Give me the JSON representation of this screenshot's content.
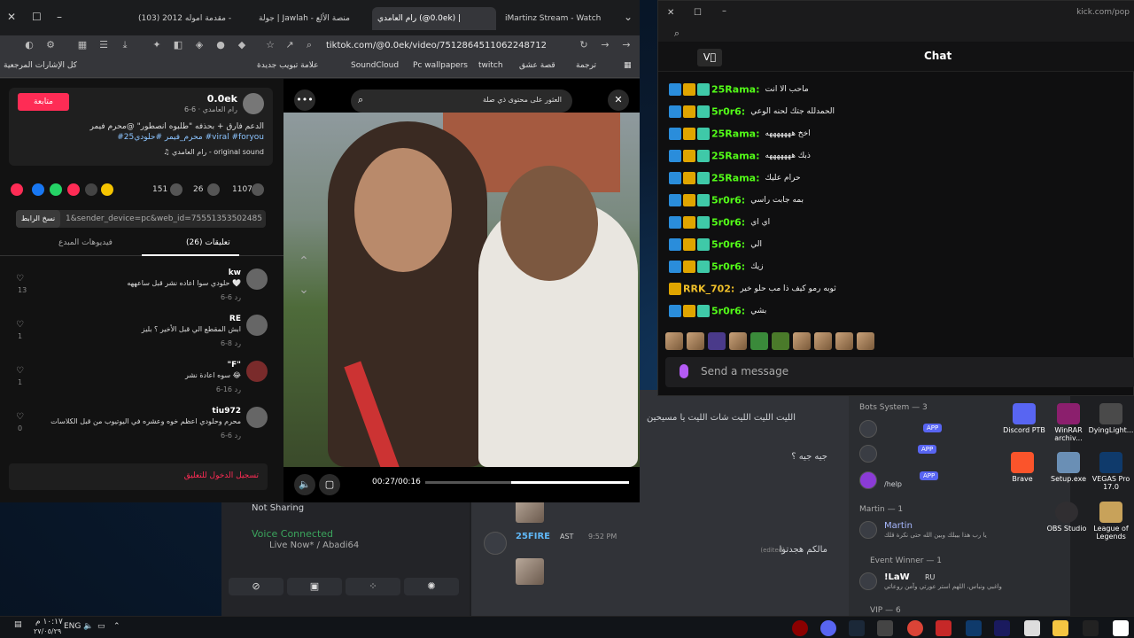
{
  "browser": {
    "tabs": [
      {
        "label": "(103) مقدمة اموله 2012 - "
      },
      {
        "label": "جولة | Jawlah - منصة الألع"
      },
      {
        "label": "رام العامدي (@0.0ek) | "
      },
      {
        "label": "iMartinz Stream - Watch"
      }
    ],
    "url": "tiktok.com/@0.0ek/video/7512864511062248712",
    "bookmarks": [
      {
        "label": "كل الإشارات المرجعية"
      },
      {
        "label": "علامة تبويب جديدة"
      },
      {
        "label": "SoundCloud"
      },
      {
        "label": "Pc wallpapers"
      },
      {
        "label": "twitch"
      },
      {
        "label": "قصة عشق"
      },
      {
        "label": "ترجمة"
      }
    ]
  },
  "tiktok": {
    "follow_label": "متابعة",
    "username": "0.0ek",
    "subtitle": "رام العامدي · 6-6",
    "description": "الدعم فارق + بحذفه \"طلبوه انصطور\" @محرم فيمر",
    "tags": "#محرم_فيمر #حلودي25 #viral #foryou",
    "sound": "رام العامدي - original sound",
    "stats": {
      "likes": "1107",
      "comments": "26",
      "saves": "151"
    },
    "copy_label": "نسخ الرابط",
    "link": "1&sender_device=pc&web_id=7555135350248506881...",
    "tab_comments": "تعليقات (26)",
    "tab_creator": "فيديوهات المبدع",
    "comments": [
      {
        "user": "kw",
        "text": "حلودي سوا اعاده نشر قبل ساعههه 🤍",
        "meta": "6-6   رد",
        "likes": "13"
      },
      {
        "user": "RE",
        "text": "ابش المقطع الي قبل الأخير ؟ بليز",
        "meta": "6-8   رد",
        "likes": "1"
      },
      {
        "user": "\"F\"",
        "text": "سوه اعادة نشر 😂",
        "meta": "6-16   رد",
        "likes": "1"
      },
      {
        "user": "tiu972",
        "text": "محرم وحلودي اعظم خوه وعشره في اليوتيوب من قبل الكلاسات",
        "meta": "6-6   رد",
        "likes": "0"
      }
    ],
    "login_prompt": "تسجيل الدخول للتعليق"
  },
  "video": {
    "search_placeholder": "العثور على محتوى ذي صلة",
    "time": "00:27/00:16",
    "progress": 0.58
  },
  "kick": {
    "url": "kick.com/pop",
    "title": "Chat",
    "logo": "V⃞",
    "messages": [
      {
        "user": "25Rama:",
        "text": "ماحب الا انت",
        "badges": 3
      },
      {
        "user": "5r0r6:",
        "text": "الحمدلله جتك لحنه الوعي",
        "badges": 3
      },
      {
        "user": "25Rama:",
        "text": "اخخ هههههههه",
        "badges": 3
      },
      {
        "user": "25Rama:",
        "text": "ذبك هههههههه",
        "badges": 3
      },
      {
        "user": "25Rama:",
        "text": "حرام عليك",
        "badges": 3
      },
      {
        "user": "5r0r6:",
        "text": "بمه جابت راسي",
        "badges": 3
      },
      {
        "user": "5r0r6:",
        "text": "اي اي",
        "badges": 3
      },
      {
        "user": "5r0r6:",
        "text": "الي",
        "badges": 3
      },
      {
        "user": "5r0r6:",
        "text": "زيك",
        "badges": 3
      },
      {
        "user": "RRK_702:",
        "text": "ثوبه رمو كيف ذا مب حلو خير",
        "badges": 1
      },
      {
        "user": "5r0r6:",
        "text": "بشي",
        "badges": 3
      }
    ],
    "send_placeholder": "Send a message"
  },
  "discord": {
    "not_sharing": "Not Sharing",
    "voice_connected": "Voice Connected",
    "voice_channel": "Live Now* / Abadi64",
    "chat_line1": "الليت الليت الليت شات الليت يا مسيحين",
    "chat_line2": "جيه جيه ؟",
    "user_25fire": "25FIRE",
    "tag_ast": "AST",
    "time_952": "9:52 PM",
    "edited_line": "مالكم هجدتوا",
    "edited": "(edited)",
    "bots_header": "Bots System — 3",
    "app_badge": "APP",
    "bot3_text": "/help",
    "martin_header": "Martin — 1",
    "martin_name": "Martin",
    "martin_status": "يا رب هذا بيبلك وبين الله حتى نكرة قلك",
    "event_header": "Event Winner — 1",
    "event_user": "!LaW",
    "event_tag": "RU",
    "event_status": "واغبي ونباس، اللهم استر عورتي وآمن روعاتي",
    "vip_header": "VIP — 6"
  },
  "desktop_icons": [
    {
      "label": "Discord PTB"
    },
    {
      "label": "WinRAR archiv..."
    },
    {
      "label": "DyingLight..."
    },
    {
      "label": "Brave"
    },
    {
      "label": "Setup.exe"
    },
    {
      "label": "VEGAS Pro 17.0"
    },
    {
      "label": "OBS Studio"
    },
    {
      "label": "League of Legends"
    }
  ],
  "taskbar": {
    "time": "١٠:١٧ م",
    "date": "٢٧/٠٥/٢٩",
    "lang": "ENG"
  }
}
